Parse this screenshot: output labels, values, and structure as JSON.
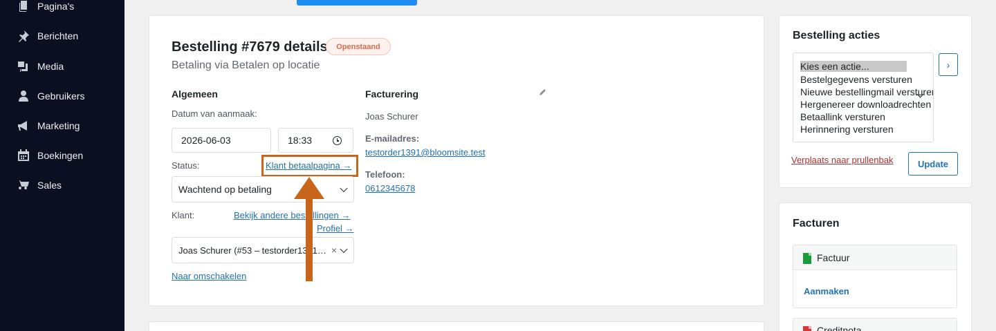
{
  "sidebar": {
    "items": [
      {
        "label": "Pagina's",
        "icon": "pages-icon"
      },
      {
        "label": "Berichten",
        "icon": "pin-icon"
      },
      {
        "label": "Media",
        "icon": "media-icon"
      },
      {
        "label": "Gebruikers",
        "icon": "user-icon"
      },
      {
        "label": "Marketing",
        "icon": "megaphone-icon"
      },
      {
        "label": "Boekingen",
        "icon": "calendar-icon"
      },
      {
        "label": "Sales",
        "icon": "cart-icon"
      }
    ]
  },
  "order": {
    "title": "Bestelling #7679 details",
    "badge": "Openstaand",
    "subtitle": "Betaling via Betalen op locatie"
  },
  "general": {
    "heading": "Algemeen",
    "date_label": "Datum van aanmaak:",
    "date_value": "2026-06-03",
    "time_value": "18:33",
    "status_label": "Status:",
    "payment_page_link": "Klant betaalpagina →",
    "status_value": "Wachtend op betaling",
    "customer_label": "Klant:",
    "other_orders_link": "Bekijk andere bestellingen →",
    "profile_link": "Profiel →",
    "customer_value": "Joas Schurer (#53 – testorder1391…",
    "switch_link": "Naar omschakelen"
  },
  "billing": {
    "heading": "Facturering",
    "name": "Joas Schurer",
    "email_label": "E-mailadres:",
    "email": "testorder1391@bloomsite.test",
    "phone_label": "Telefoon:",
    "phone": "0612345678"
  },
  "actions": {
    "heading": "Bestelling acties",
    "options": [
      "Kies een actie...",
      "Bestelgegevens versturen",
      "Nieuwe bestellingmail versturen",
      "Hergenereer downloadrechten",
      "Betaallink versturen",
      "Herinnering versturen"
    ],
    "go_button": "›",
    "trash_link": "Verplaats naar prullenbak",
    "update_button": "Update"
  },
  "invoices": {
    "heading": "Facturen",
    "invoice_label": "Factuur",
    "create_link": "Aanmaken",
    "credit_label": "Creditnota"
  },
  "colors": {
    "sidebar_bg": "#0a0f22",
    "accent": "#2271b1",
    "annotation": "#c8651b",
    "badge": "#e0684b"
  }
}
